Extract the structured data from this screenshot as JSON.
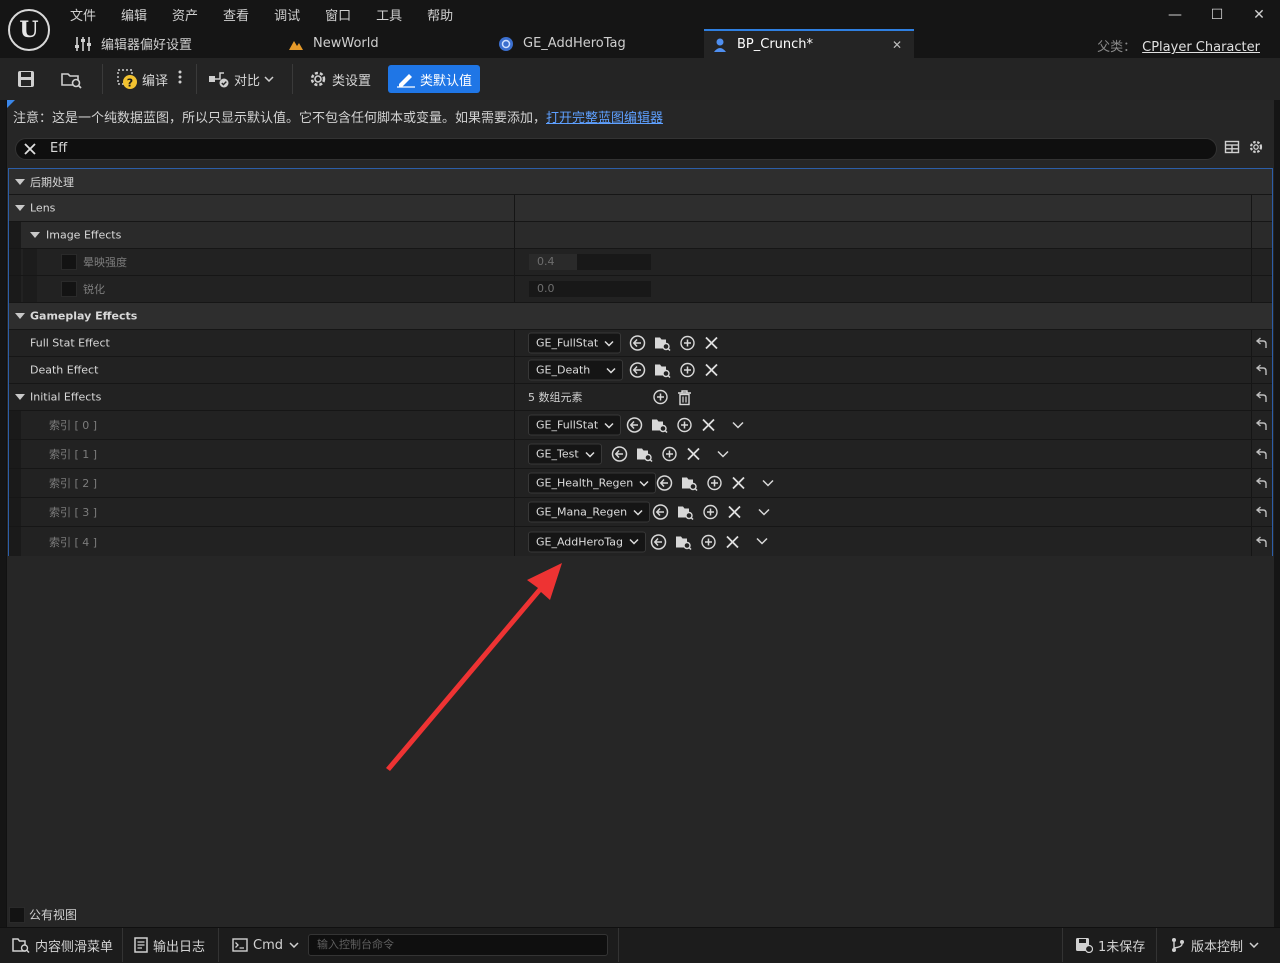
{
  "menu": [
    "文件",
    "编辑",
    "资产",
    "查看",
    "调试",
    "窗口",
    "工具",
    "帮助"
  ],
  "tabs": [
    {
      "label": "编辑器偏好设置"
    },
    {
      "label": "NewWorld"
    },
    {
      "label": "GE_AddHeroTag"
    },
    {
      "label": "BP_Crunch*"
    }
  ],
  "parent": {
    "label": "父类：",
    "value": "CPlayer Character"
  },
  "toolbar": {
    "compile": "编译",
    "diff": "对比",
    "class_settings": "类设置",
    "class_defaults": "类默认值"
  },
  "notice": {
    "text": "注意：这是一个纯数据蓝图，所以只显示默认值。它不包含任何脚本或变量。如果需要添加，",
    "link": "打开完整蓝图编辑器"
  },
  "search": {
    "value": "Eff"
  },
  "details": {
    "post_process": "后期处理",
    "lens": "Lens",
    "image_effects": "Image Effects",
    "vignette": {
      "label": "晕映强度",
      "value": "0.4",
      "fill": 0.4
    },
    "sharpen": {
      "label": "锐化",
      "value": "0.0",
      "fill": 0.0
    },
    "gameplay_effects": "Gameplay Effects",
    "full_stat": {
      "label": "Full Stat Effect",
      "value": "GE_FullStat"
    },
    "death": {
      "label": "Death Effect",
      "value": "GE_Death"
    },
    "initial": {
      "label": "Initial Effects",
      "count": "5 数组元素"
    },
    "indices": [
      {
        "label": "索引 [ 0 ]",
        "value": "GE_FullStat"
      },
      {
        "label": "索引 [ 1 ]",
        "value": "GE_Test"
      },
      {
        "label": "索引 [ 2 ]",
        "value": "GE_Health_Regen"
      },
      {
        "label": "索引 [ 3 ]",
        "value": "GE_Mana_Regen"
      },
      {
        "label": "索引 [ 4 ]",
        "value": "GE_AddHeroTag"
      }
    ]
  },
  "public_view": "公有视图",
  "status": {
    "content_drawer": "内容侧滑菜单",
    "output_log": "输出日志",
    "cmd": "Cmd",
    "console_placeholder": "输入控制台命令",
    "unsaved": "1未保存",
    "source_control": "版本控制"
  },
  "colors": {
    "accent": "#1f76e6",
    "annotation": "#ee3333"
  }
}
